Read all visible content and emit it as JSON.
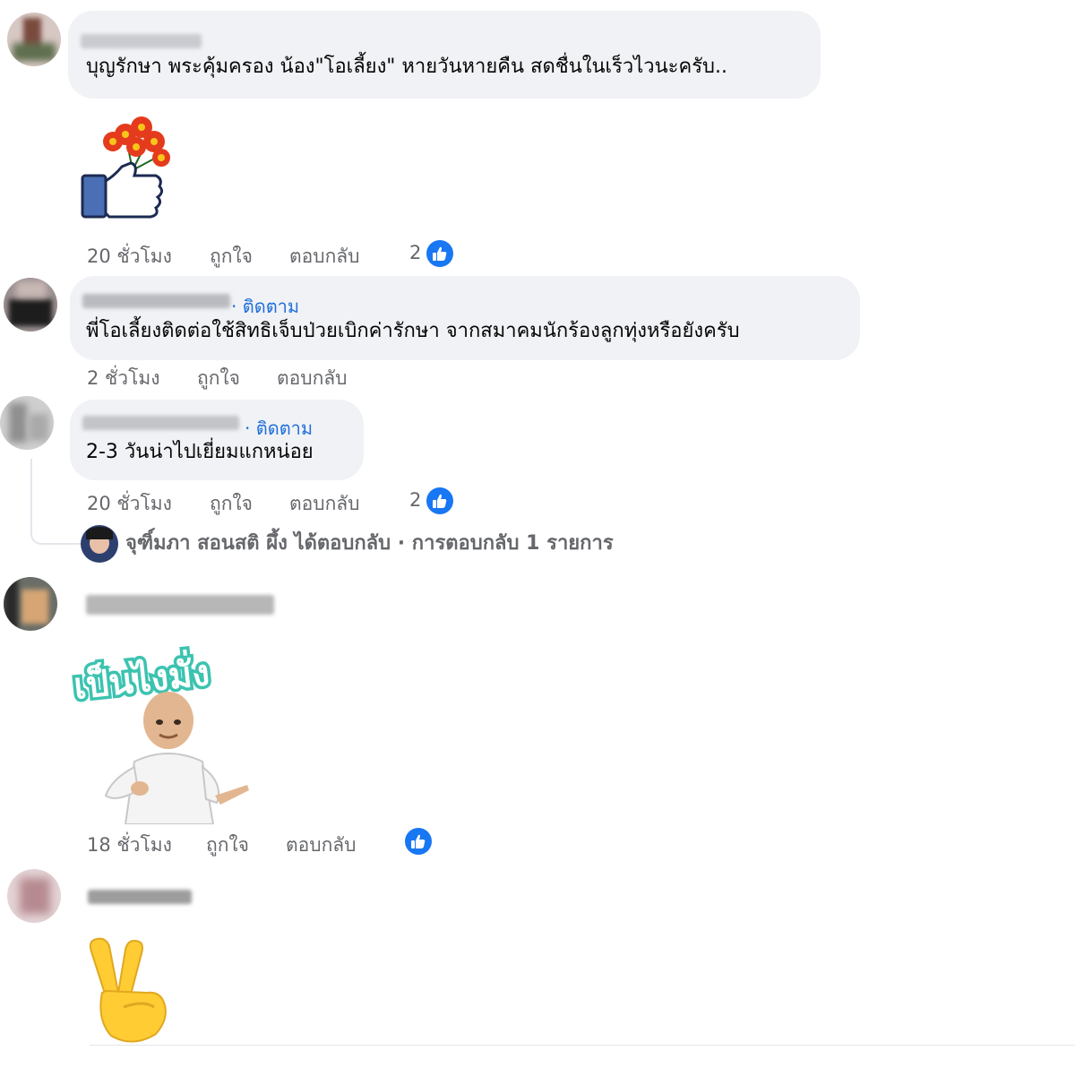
{
  "comments": [
    {
      "text": "บุญรักษา พระคุ้มครอง น้อง\"โอเลี้ยง\" หายวันหายคืน สดชื่นในเร็วไวนะครับ..",
      "sticker": "flower-thumbs-up-sticker",
      "meta": {
        "time": "20 ชั่วโมง",
        "like": "ถูกใจ",
        "reply": "ตอบกลับ",
        "reactions": "2"
      }
    },
    {
      "follow": "· ติดตาม",
      "text": "พี่โอเลี้ยงติดต่อใช้สิทธิเจ็บป่วยเบิกค่ารักษา จากสมาคมนักร้องลูกทุ่งหรือยังครับ",
      "meta": {
        "time": "2 ชั่วโมง",
        "like": "ถูกใจ",
        "reply": "ตอบกลับ"
      }
    },
    {
      "follow": "· ติดตาม",
      "text": "2-3 วันน่าไปเยี่ยมแกหน่อย",
      "meta": {
        "time": "20 ชั่วโมง",
        "like": "ถูกใจ",
        "reply": "ตอบกลับ",
        "reactions": "2"
      },
      "reply_summary": "จุฑิ์มภา สอนสติ ผึ้ง ได้ตอบกลับ · การตอบกลับ 1 รายการ"
    },
    {
      "sticker_text": "เป็นไงมั่ง",
      "sticker": "bald-man-pointing-sticker",
      "meta": {
        "time": "18 ชั่วโมง",
        "like": "ถูกใจ",
        "reply": "ตอบกลับ"
      }
    },
    {
      "sticker": "victory-hand-emoji"
    }
  ],
  "colors": {
    "bubble": "#f0f2f5",
    "link": "#216fdb",
    "meta": "#65676b",
    "like": "#1877f2",
    "sticker_text": "#3cc3b0"
  },
  "icons": {
    "like": "like-thumbs-up-icon",
    "victory": "victory-hand-icon"
  }
}
